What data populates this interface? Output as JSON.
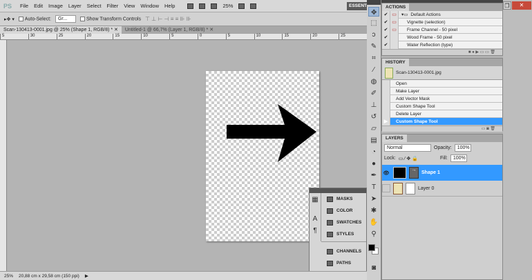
{
  "app": {
    "logo": "PS",
    "workspace_label": "ESSENTIALS"
  },
  "menu": [
    "File",
    "Edit",
    "Image",
    "Layer",
    "Select",
    "Filter",
    "View",
    "Window",
    "Help"
  ],
  "appbar": {
    "zoom": "25%"
  },
  "options": {
    "auto_select_label": "Auto-Select:",
    "auto_select_value": "Gr...",
    "show_transform_label": "Show Transform Controls"
  },
  "tabs": [
    {
      "label": "Scan-130413-0001.jpg @ 25% (Shape 1, RGB/8) *",
      "active": true
    },
    {
      "label": "Untitled-1 @ 66,7% (Layer 1, RGB/8) *",
      "active": false
    }
  ],
  "ruler": {
    "ticks": [
      "5",
      "30",
      "25",
      "20",
      "15",
      "10",
      "5",
      "0",
      "5",
      "10",
      "15",
      "20",
      "25"
    ]
  },
  "status": {
    "zoom": "25%",
    "doc_size": "20,88 cm x 29,58 cm (150 ppi)"
  },
  "float_panel": {
    "items": [
      "MASKS",
      "COLOR",
      "SWATCHES",
      "STYLES",
      "CHANNELS",
      "PATHS"
    ]
  },
  "actions": {
    "title": "ACTIONS",
    "set": "Default Actions",
    "items": [
      "Vignette (selection)",
      "Frame Channel - 50 pixel",
      "Wood Frame - 50 pixel",
      "Water Reflection (type)"
    ]
  },
  "history": {
    "title": "HISTORY",
    "snapshot": "Scan-130413-0001.jpg",
    "items": [
      "Open",
      "Make Layer",
      "Add Vector Mask",
      "Custom Shape Tool",
      "Delete Layer",
      "Custom Shape Tool"
    ],
    "selected_index": 5
  },
  "layers": {
    "title": "LAYERS",
    "blend_mode": "Normal",
    "opacity_label": "Opacity:",
    "opacity": "100%",
    "lock_label": "Lock:",
    "fill_label": "Fill:",
    "fill": "100%",
    "items": [
      {
        "name": "Shape 1",
        "selected": true,
        "visible": true
      },
      {
        "name": "Layer 0",
        "selected": false,
        "visible": false
      }
    ]
  },
  "colors": {
    "accent": "#3399ff",
    "foreground": "#000000",
    "background": "#ffffff"
  }
}
